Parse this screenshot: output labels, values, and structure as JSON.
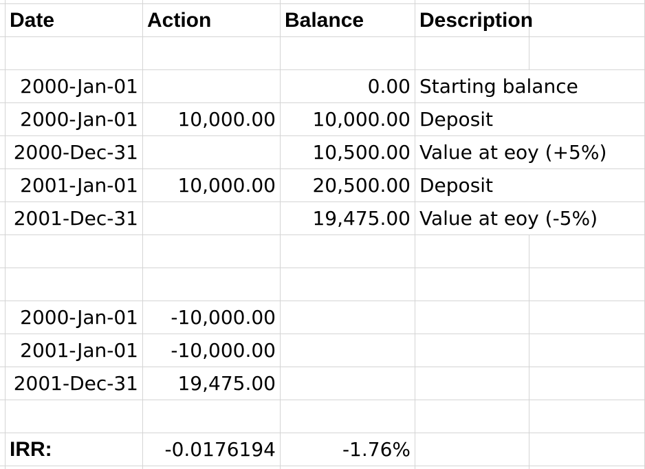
{
  "header": {
    "col_date": "Date",
    "col_action": "Action",
    "col_balance": "Balance",
    "col_description": "Description"
  },
  "rows": [
    {
      "date": "2000-Jan-01",
      "action": "",
      "balance": "0.00",
      "description": "Starting balance"
    },
    {
      "date": "2000-Jan-01",
      "action": "10,000.00",
      "balance": "10,000.00",
      "description": "Deposit"
    },
    {
      "date": "2000-Dec-31",
      "action": "",
      "balance": "10,500.00",
      "description": "Value at eoy (+5%)"
    },
    {
      "date": "2001-Jan-01",
      "action": "10,000.00",
      "balance": "20,500.00",
      "description": "Deposit"
    },
    {
      "date": "2001-Dec-31",
      "action": "",
      "balance": "19,475.00",
      "description": "Value at eoy (-5%)"
    }
  ],
  "cashflows": [
    {
      "date": "2000-Jan-01",
      "amount": "-10,000.00"
    },
    {
      "date": "2001-Jan-01",
      "amount": "-10,000.00"
    },
    {
      "date": "2001-Dec-31",
      "amount": "19,475.00"
    }
  ],
  "irr": {
    "label": "IRR:",
    "value": "-0.0176194",
    "percent": "-1.76%"
  }
}
